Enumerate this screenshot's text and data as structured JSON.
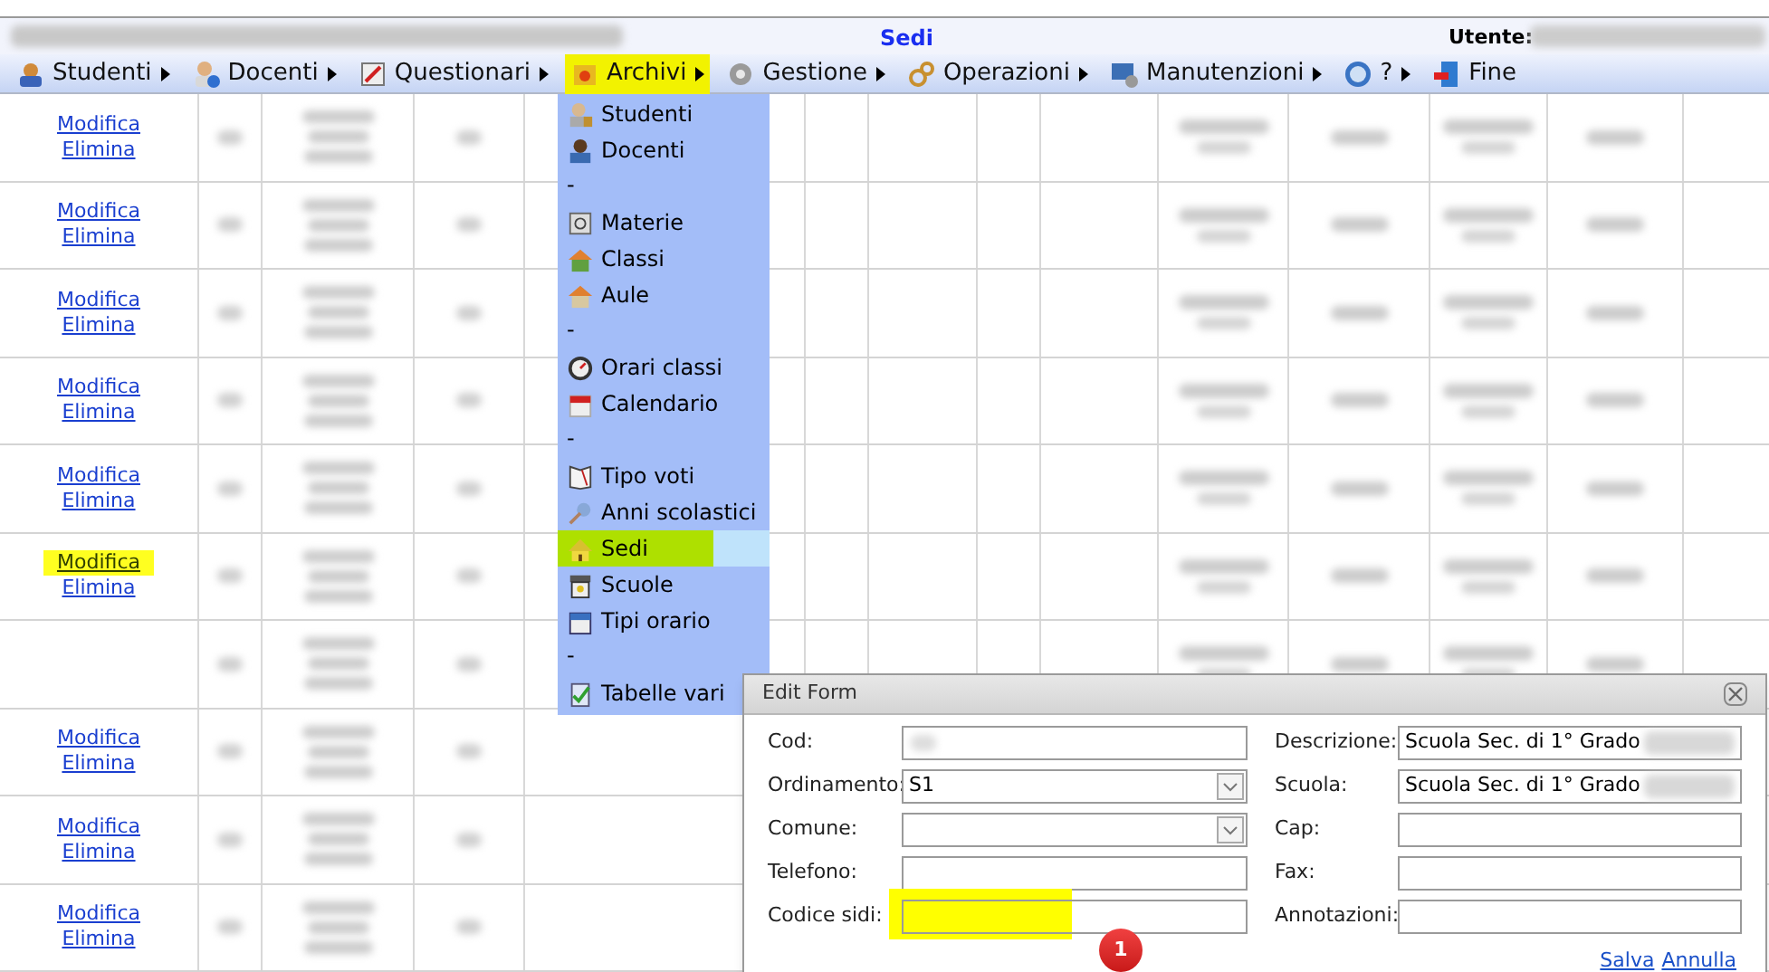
{
  "header": {
    "title": "Sedi",
    "user_label": "Utente:"
  },
  "menu": [
    {
      "label": "Studenti",
      "submenu": true,
      "selected": false
    },
    {
      "label": "Docenti",
      "submenu": true,
      "selected": false
    },
    {
      "label": "Questionari",
      "submenu": true,
      "selected": false
    },
    {
      "label": "Archivi",
      "submenu": true,
      "selected": true
    },
    {
      "label": "Gestione",
      "submenu": true,
      "selected": false
    },
    {
      "label": "Operazioni",
      "submenu": true,
      "selected": false
    },
    {
      "label": "Manutenzioni",
      "submenu": true,
      "selected": false
    },
    {
      "label": "?",
      "submenu": true,
      "selected": false
    },
    {
      "label": "Fine",
      "submenu": false,
      "selected": false
    }
  ],
  "dropdown": [
    {
      "kind": "item",
      "label": "Studenti",
      "selected": false
    },
    {
      "kind": "item",
      "label": "Docenti",
      "selected": false
    },
    {
      "kind": "separator",
      "label": "-"
    },
    {
      "kind": "item",
      "label": "Materie",
      "selected": false
    },
    {
      "kind": "item",
      "label": "Classi",
      "selected": false
    },
    {
      "kind": "item",
      "label": "Aule",
      "selected": false
    },
    {
      "kind": "separator",
      "label": "-"
    },
    {
      "kind": "item",
      "label": "Orari classi",
      "selected": false
    },
    {
      "kind": "item",
      "label": "Calendario",
      "selected": false
    },
    {
      "kind": "separator",
      "label": "-"
    },
    {
      "kind": "item",
      "label": "Tipo voti",
      "selected": false
    },
    {
      "kind": "item",
      "label": "Anni scolastici",
      "selected": false
    },
    {
      "kind": "item",
      "label": "Sedi",
      "selected": true
    },
    {
      "kind": "item",
      "label": "Scuole",
      "selected": false
    },
    {
      "kind": "item",
      "label": "Tipi orario",
      "selected": false
    },
    {
      "kind": "separator",
      "label": "-"
    },
    {
      "kind": "item",
      "label": "Tabelle vari",
      "selected": false
    }
  ],
  "rows": [
    {
      "kind": "actions",
      "links": [
        "Modifica",
        "Elimina"
      ],
      "highlighted": false
    },
    {
      "kind": "actions",
      "links": [
        "Modifica",
        "Elimina"
      ],
      "highlighted": false
    },
    {
      "kind": "actions",
      "links": [
        "Modifica",
        "Elimina"
      ],
      "highlighted": false
    },
    {
      "kind": "actions",
      "links": [
        "Modifica",
        "Elimina"
      ],
      "highlighted": false
    },
    {
      "kind": "actions",
      "links": [
        "Modifica",
        "Elimina"
      ],
      "highlighted": false
    },
    {
      "kind": "actions",
      "links": [
        "Modifica",
        "Elimina"
      ],
      "highlighted": true
    },
    {
      "kind": "empty"
    },
    {
      "kind": "actions",
      "links": [
        "Modifica",
        "Elimina"
      ],
      "highlighted": false
    },
    {
      "kind": "actions",
      "links": [
        "Modifica",
        "Elimina"
      ],
      "highlighted": false
    },
    {
      "kind": "actions",
      "links": [
        "Modifica",
        "Elimina"
      ],
      "highlighted": false
    }
  ],
  "dialog": {
    "title": "Edit Form",
    "left_fields": [
      {
        "label": "Cod:",
        "kind": "text",
        "highlighted": false
      },
      {
        "label": "Ordinamento:",
        "kind": "select",
        "value": "S1",
        "highlighted": false
      },
      {
        "label": "Comune:",
        "kind": "select",
        "highlighted": false
      },
      {
        "label": "Telefono:",
        "kind": "text",
        "highlighted": false
      },
      {
        "label": "Codice sidi:",
        "kind": "text",
        "highlighted": true
      }
    ],
    "right_fields": [
      {
        "label": "Descrizione:",
        "kind": "text",
        "value": "Scuola Sec. di 1° Grado",
        "highlighted": false
      },
      {
        "label": "Scuola:",
        "kind": "text",
        "value": "Scuola Sec. di 1° Grado",
        "highlighted": false
      },
      {
        "label": "Cap:",
        "kind": "text",
        "highlighted": false
      },
      {
        "label": "Fax:",
        "kind": "text",
        "highlighted": false
      },
      {
        "label": "Annotazioni:",
        "kind": "text",
        "highlighted": false
      }
    ],
    "actions": [
      "Salva",
      "Annulla"
    ],
    "badge": "1"
  }
}
